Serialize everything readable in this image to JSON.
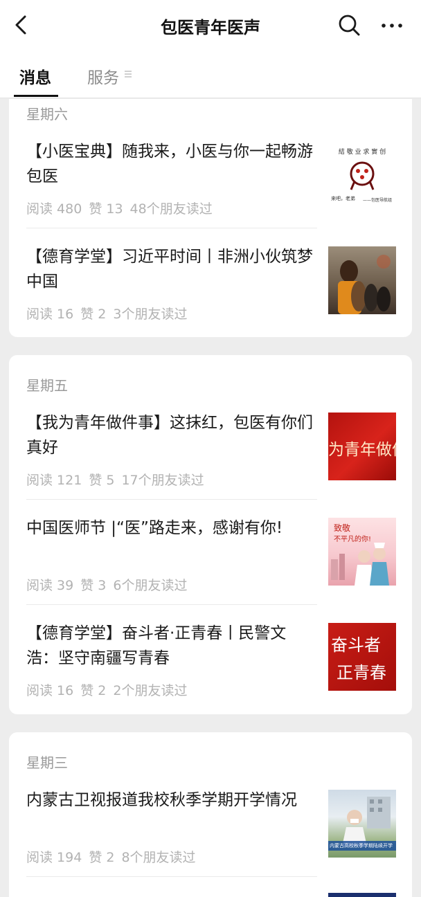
{
  "header": {
    "title": "包医青年医声"
  },
  "tabs": [
    {
      "label": "消息",
      "active": true
    },
    {
      "label": "服务",
      "active": false
    }
  ],
  "groups": [
    {
      "day": "星期六",
      "articles": [
        {
          "title": "【小医宝典】随我来，小医与你一起畅游包医",
          "reads": "阅读 480",
          "likes": "赞 13",
          "friends": "48个朋友读过",
          "thumb": {
            "top_text": "結 敬 业 求 實 创",
            "bottom_left": "来吧，老弟",
            "bottom_right": "——包医导航组"
          }
        },
        {
          "title": "【德育学堂】习近平时间丨非洲小伙筑梦中国",
          "reads": "阅读 16",
          "likes": "赞 2",
          "friends": "3个朋友读过"
        }
      ]
    },
    {
      "day": "星期五",
      "articles": [
        {
          "title": "【我为青年做件事】这抹红，包医有你们真好",
          "reads": "阅读 121",
          "likes": "赞 5",
          "friends": "17个朋友读过",
          "thumb": {
            "text": "为青年做件"
          }
        },
        {
          "title": "中国医师节 |“医”路走来，感谢有你!",
          "reads": "阅读 39",
          "likes": "赞 3",
          "friends": "6个朋友读过",
          "thumb": {
            "line1": "致敬",
            "line2": "不平凡的你!"
          }
        },
        {
          "title": "【德育学堂】奋斗者·正青春丨民警文浩：坚守南疆写青春",
          "reads": "阅读 16",
          "likes": "赞 2",
          "friends": "2个朋友读过",
          "thumb": {
            "line1": "奋斗者",
            "line2": "正青春"
          }
        }
      ]
    },
    {
      "day": "星期三",
      "articles": [
        {
          "title": "内蒙古卫视报道我校秋季学期开学情况",
          "reads": "阅读 194",
          "likes": "赞 2",
          "friends": "8个朋友读过",
          "thumb": {
            "caption": "内蒙古高校秋季学期陆续开学"
          }
        }
      ]
    }
  ],
  "colors": {
    "background": "#ededed",
    "card": "#ffffff",
    "title_text": "#1a1a1a",
    "meta_text": "#b2b2b2",
    "red_banner": "#d8231b"
  },
  "icons": {
    "back": "chevron-left-icon",
    "search": "search-icon",
    "more": "more-icon",
    "tab_menu": "menu-lines-icon"
  }
}
